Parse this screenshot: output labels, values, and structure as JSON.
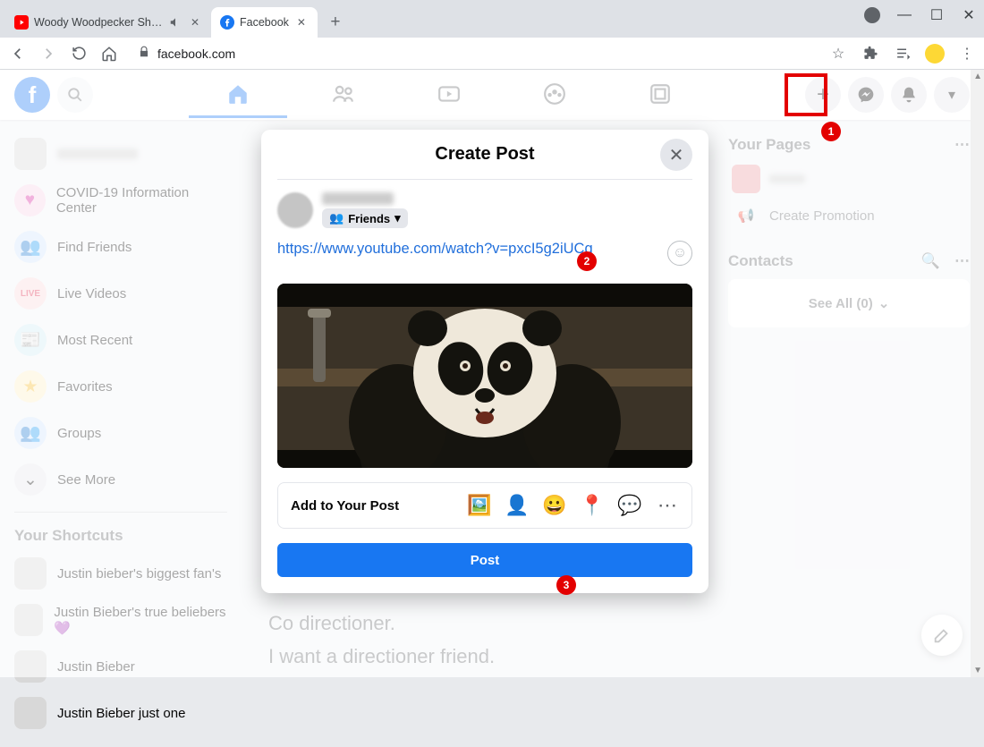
{
  "browser": {
    "tabs": [
      {
        "title": "Woody Woodpecker Show |",
        "muted": true
      },
      {
        "title": "Facebook"
      }
    ],
    "url": "facebook.com"
  },
  "fb_header": {
    "nav": [
      "home",
      "friends",
      "watch",
      "groups",
      "gaming"
    ]
  },
  "left_rail": {
    "items": [
      {
        "label": "COVID-19 Information Center",
        "style": "pink"
      },
      {
        "label": "Find Friends",
        "style": "blue"
      },
      {
        "label": "Live Videos",
        "style": "red"
      },
      {
        "label": "Most Recent",
        "style": "teal"
      },
      {
        "label": "Favorites",
        "style": "yel"
      },
      {
        "label": "Groups",
        "style": "blue"
      },
      {
        "label": "See More"
      }
    ],
    "shortcuts_title": "Your Shortcuts",
    "shortcuts": [
      "Justin bieber's biggest fan's",
      "Justin Bieber's true beliebers 💜",
      "Justin Bieber",
      "Justin Bieber just one"
    ]
  },
  "right_rail": {
    "pages_title": "Your Pages",
    "promote": "Create Promotion",
    "contacts_title": "Contacts",
    "see_all": "See All (0)"
  },
  "modal": {
    "title": "Create Post",
    "privacy_label": "Friends",
    "link_text": "https://www.youtube.com/watch?v=pxcI5g2iUCg",
    "add_label": "Add to Your Post",
    "post_label": "Post"
  },
  "feed_bg": {
    "line1": "Co directioner.",
    "line2": "I want a directioner friend."
  },
  "annotations": {
    "a1": "1",
    "a2": "2",
    "a3": "3"
  }
}
